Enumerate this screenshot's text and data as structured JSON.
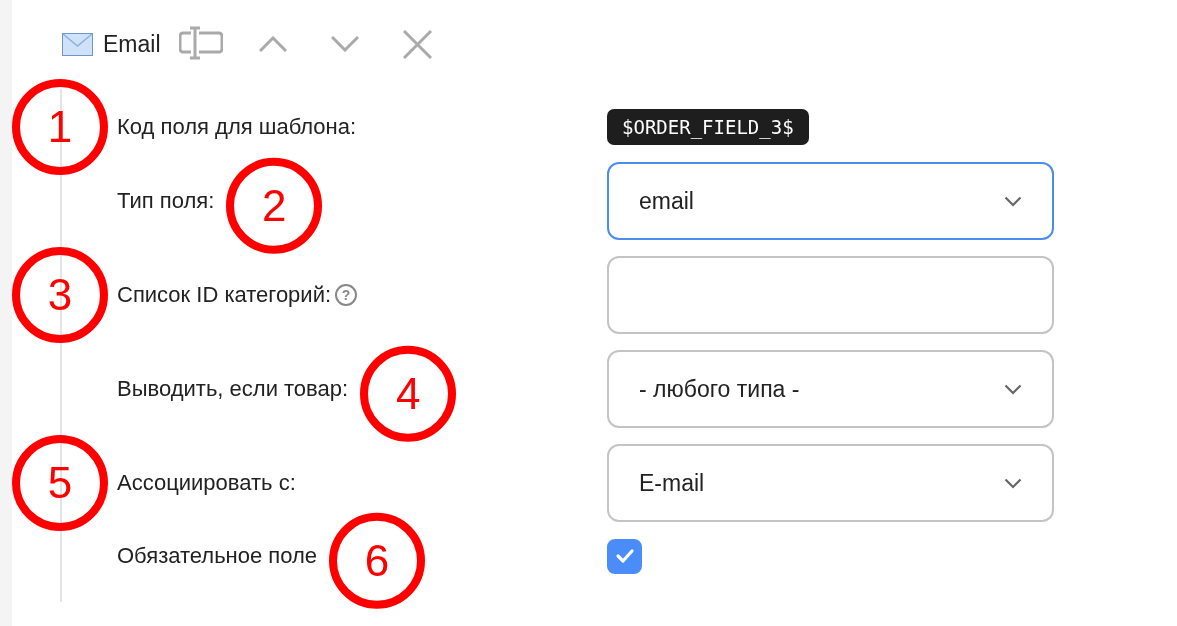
{
  "header": {
    "title": "Email"
  },
  "rows": [
    {
      "kind": "code",
      "label": "Код поля для шаблона:",
      "value": "$ORDER_FIELD_3$",
      "marker": {
        "label": "1",
        "on_line": true
      }
    },
    {
      "kind": "select",
      "label": "Тип поля:",
      "value": "email",
      "focused": true,
      "marker": {
        "label": "2",
        "on_line": false
      }
    },
    {
      "kind": "text",
      "label": "Список ID категорий:",
      "help": "?",
      "focused": false,
      "marker": {
        "label": "3",
        "on_line": true
      }
    },
    {
      "kind": "select",
      "label": "Выводить, если товар:",
      "value": "- любого типа -",
      "focused": false,
      "marker": {
        "label": "4",
        "on_line": false
      }
    },
    {
      "kind": "select",
      "label": "Ассоциировать с:",
      "value": "E-mail",
      "focused": false,
      "marker": {
        "label": "5",
        "on_line": true
      }
    },
    {
      "kind": "checkbox",
      "label": "Обязательное поле",
      "checked": true,
      "marker": {
        "label": "6",
        "on_line": false
      }
    }
  ]
}
